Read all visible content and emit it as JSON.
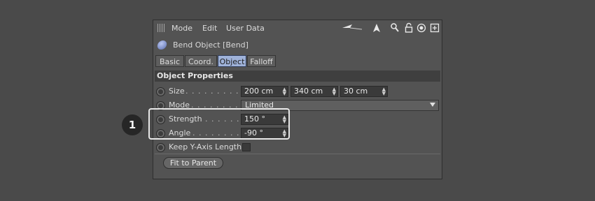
{
  "menubar": {
    "items": [
      "Mode",
      "Edit",
      "User Data"
    ],
    "tools": [
      "back-arrow-icon",
      "up-arrow-icon",
      "search-icon",
      "lock-icon",
      "target-icon",
      "new-panel-icon"
    ]
  },
  "object": {
    "title": "Bend Object [Bend]",
    "icon": "bend-object-icon"
  },
  "tabs": [
    {
      "label": "Basic",
      "active": false
    },
    {
      "label": "Coord.",
      "active": false
    },
    {
      "label": "Object",
      "active": true
    },
    {
      "label": "Falloff",
      "active": false
    }
  ],
  "section": {
    "title": "Object Properties"
  },
  "properties": {
    "size": {
      "label": "Size",
      "dots": ". . . . . . . . . . . .",
      "values": [
        "200 cm",
        "340 cm",
        "30 cm"
      ]
    },
    "mode": {
      "label": "Mode",
      "dots": ". . . . . . . . . . . . .",
      "value": "Limited"
    },
    "strength": {
      "label": "Strength",
      "dots": ". . . . . . . . .",
      "value": "150 °"
    },
    "angle": {
      "label": "Angle",
      "dots": ". . . . . . . . . . .",
      "value": "-90 °"
    },
    "keep_y": {
      "label": "Keep Y-Axis Length",
      "checked": false
    }
  },
  "fit_button": {
    "label": "Fit to Parent"
  },
  "callout": {
    "number": "1"
  },
  "colors": {
    "active_tab": "#9fb2d9",
    "panel_bg": "#535353",
    "page_bg": "#4a4a4a"
  }
}
